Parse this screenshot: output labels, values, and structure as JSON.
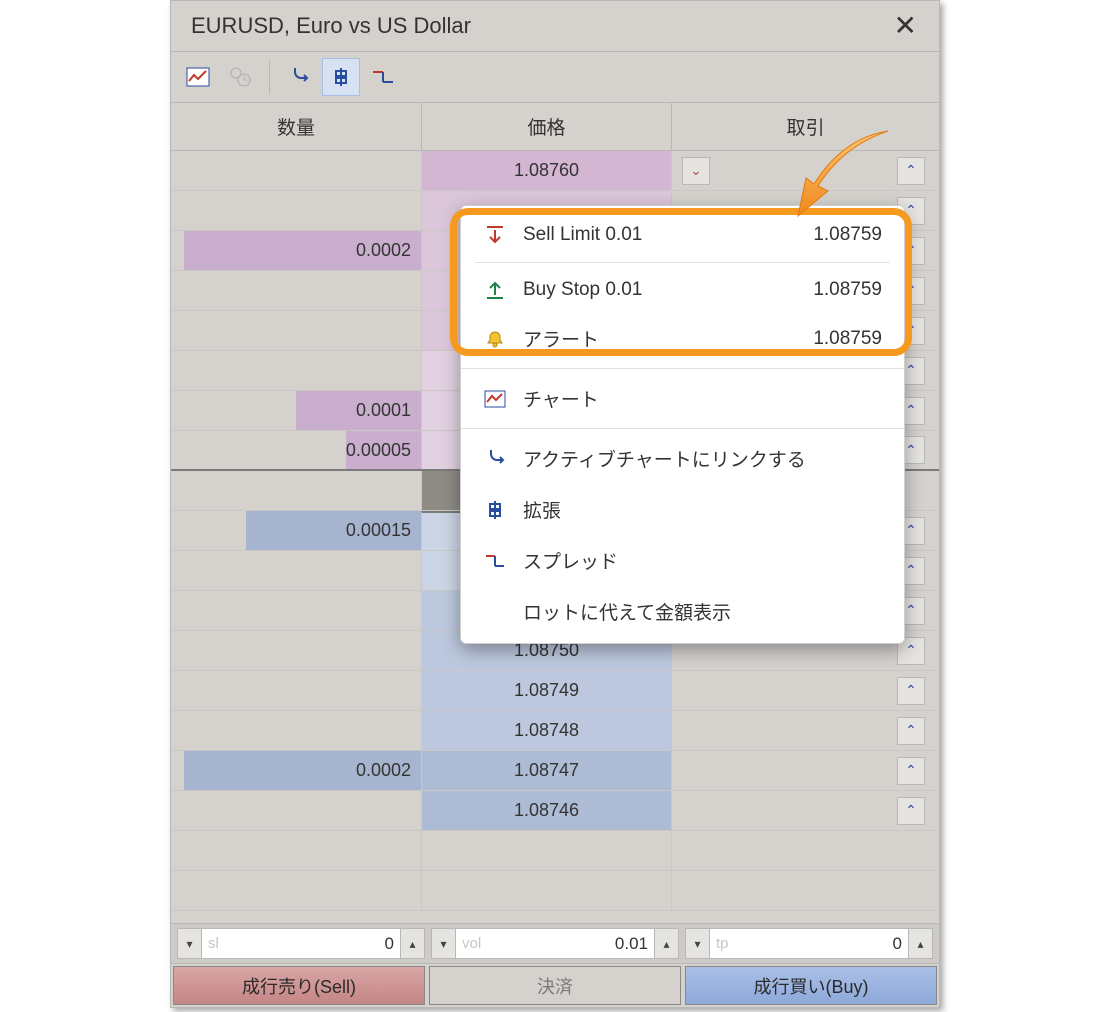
{
  "window": {
    "title": "EURUSD, Euro vs US Dollar"
  },
  "columns": {
    "qty": "数量",
    "price": "価格",
    "trade": "取引"
  },
  "rows": [
    {
      "qty": "",
      "qtyBarAsk": 0,
      "price": "1.08760",
      "bg": "ask-strong",
      "first": true
    },
    {
      "qty": "",
      "qtyBarAsk": 0,
      "price": "",
      "bg": "ask"
    },
    {
      "qty": "0.0002",
      "qtyBarAsk": 95,
      "price": "",
      "bg": "ask"
    },
    {
      "qty": "",
      "qtyBarAsk": 0,
      "price": "",
      "bg": "ask"
    },
    {
      "qty": "",
      "qtyBarAsk": 0,
      "price": "",
      "bg": "ask"
    },
    {
      "qty": "",
      "qtyBarAsk": 0,
      "price": "",
      "bg": "ask-light"
    },
    {
      "qty": "0.0001",
      "qtyBarAsk": 50,
      "price": "",
      "bg": "ask-light"
    },
    {
      "qty": "0.00005",
      "qtyBarAsk": 30,
      "price": "",
      "bg": "ask-light",
      "askEnd": true
    },
    {
      "qty": "",
      "qtyBarBid": 0,
      "price": "",
      "bg": "dark"
    },
    {
      "qty": "0.00015",
      "qtyBarBid": 70,
      "price": "",
      "bg": "bid-light",
      "bidStart": true
    },
    {
      "qty": "",
      "qtyBarBid": 0,
      "price": "",
      "bg": "bid-light"
    },
    {
      "qty": "",
      "qtyBarBid": 0,
      "price": "",
      "bg": "bid"
    },
    {
      "qty": "",
      "qtyBarBid": 0,
      "price": "1.08750",
      "bg": "bid"
    },
    {
      "qty": "",
      "qtyBarBid": 0,
      "price": "1.08749",
      "bg": "bid"
    },
    {
      "qty": "",
      "qtyBarBid": 0,
      "price": "1.08748",
      "bg": "bid"
    },
    {
      "qty": "0.0002",
      "qtyBarBid": 95,
      "price": "1.08747",
      "bg": "bid-strong"
    },
    {
      "qty": "",
      "qtyBarBid": 0,
      "price": "1.08746",
      "bg": "bid-strong"
    },
    {
      "qty": "",
      "price": "",
      "bg": ""
    },
    {
      "qty": "",
      "price": "",
      "bg": ""
    }
  ],
  "inputs": {
    "sl": {
      "ph": "sl",
      "val": "0"
    },
    "vol": {
      "ph": "vol",
      "val": "0.01"
    },
    "tp": {
      "ph": "tp",
      "val": "0"
    }
  },
  "actions": {
    "sell": "成行売り(Sell)",
    "close": "決済",
    "buy": "成行買い(Buy)"
  },
  "ctx": {
    "sellLimitLabel": "Sell Limit 0.01",
    "sellLimitPrice": "1.08759",
    "buyStopLabel": "Buy Stop 0.01",
    "buyStopPrice": "1.08759",
    "alertLabel": "アラート",
    "alertPrice": "1.08759",
    "chart": "チャート",
    "linkActive": "アクティブチャートにリンクする",
    "extended": "拡張",
    "spread": "スプレッド",
    "showAmount": "ロットに代えて金額表示"
  }
}
